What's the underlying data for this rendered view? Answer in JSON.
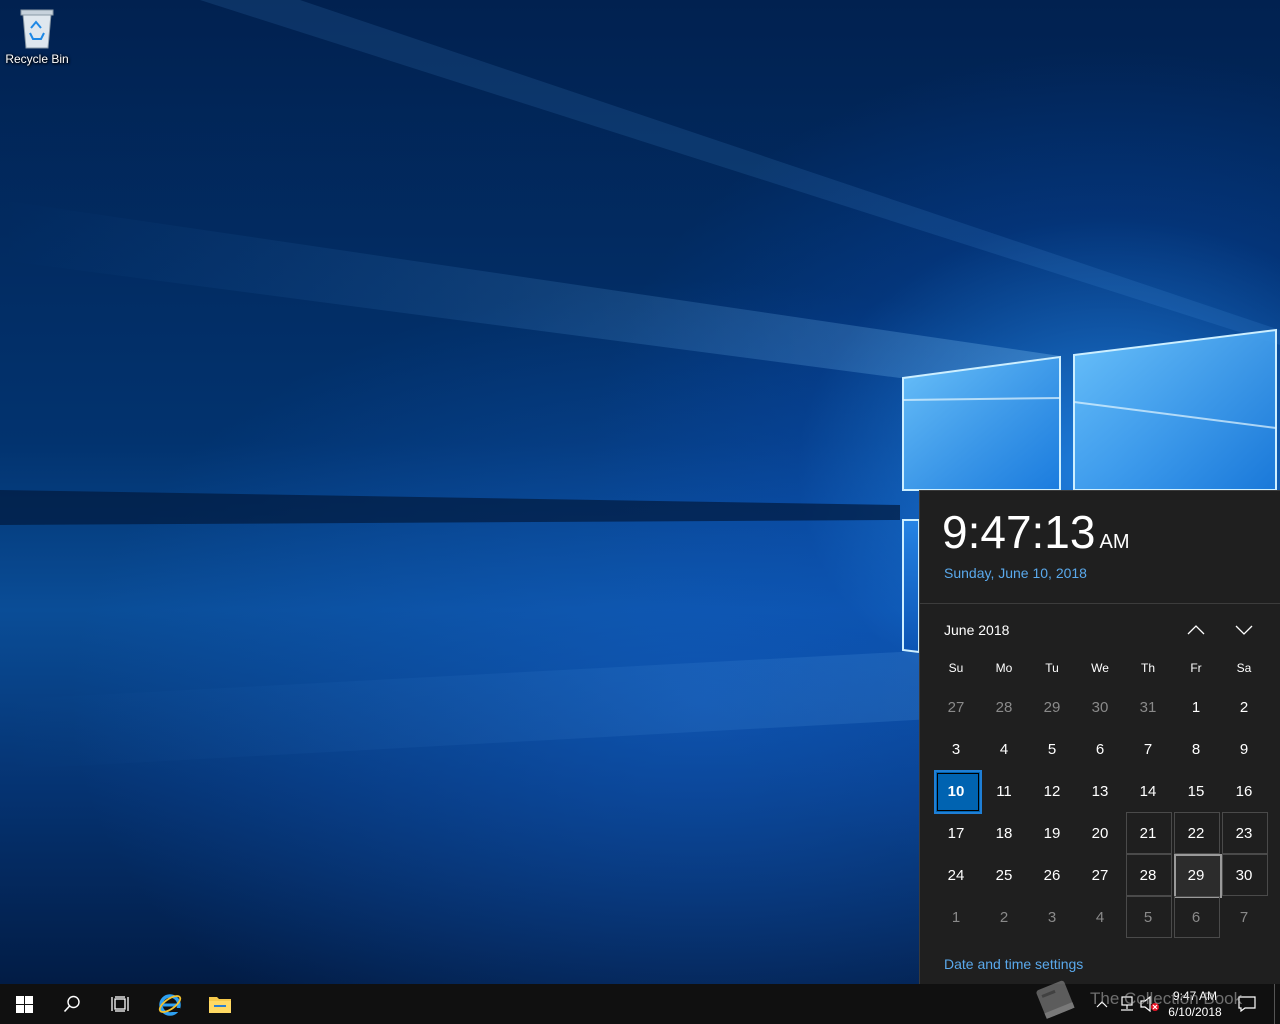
{
  "desktop": {
    "icons": [
      {
        "label": "Recycle Bin",
        "icon": "recycle-bin-icon"
      }
    ]
  },
  "flyout": {
    "time": "9:47:13",
    "ampm": "AM",
    "date_long": "Sunday, June 10, 2018",
    "month_label": "June 2018",
    "prev_icon": "chevron-up-icon",
    "next_icon": "chevron-down-icon",
    "weekdays": [
      "Su",
      "Mo",
      "Tu",
      "We",
      "Th",
      "Fr",
      "Sa"
    ],
    "weeks": [
      [
        "27",
        "28",
        "29",
        "30",
        "31",
        "1",
        "2"
      ],
      [
        "3",
        "4",
        "5",
        "6",
        "7",
        "8",
        "9"
      ],
      [
        "10",
        "11",
        "12",
        "13",
        "14",
        "15",
        "16"
      ],
      [
        "17",
        "18",
        "19",
        "20",
        "21",
        "22",
        "23"
      ],
      [
        "24",
        "25",
        "26",
        "27",
        "28",
        "29",
        "30"
      ],
      [
        "1",
        "2",
        "3",
        "4",
        "5",
        "6",
        "7"
      ]
    ],
    "today": "10",
    "settings_link": "Date and time settings"
  },
  "taskbar": {
    "buttons": [
      {
        "name": "start-button",
        "icon": "windows-logo-icon"
      },
      {
        "name": "search-button",
        "icon": "search-icon"
      },
      {
        "name": "task-view-button",
        "icon": "task-view-icon"
      },
      {
        "name": "ie-button",
        "icon": "internet-explorer-icon"
      },
      {
        "name": "explorer-button",
        "icon": "folder-icon"
      }
    ],
    "watermark": "The Collection Book",
    "tray": {
      "time": "9:47 AM",
      "date": "6/10/2018"
    }
  },
  "colors": {
    "accent": "#0063b1",
    "link": "#5aa9ec",
    "flyout_bg": "#1f1f1f",
    "taskbar_bg": "#101010"
  }
}
